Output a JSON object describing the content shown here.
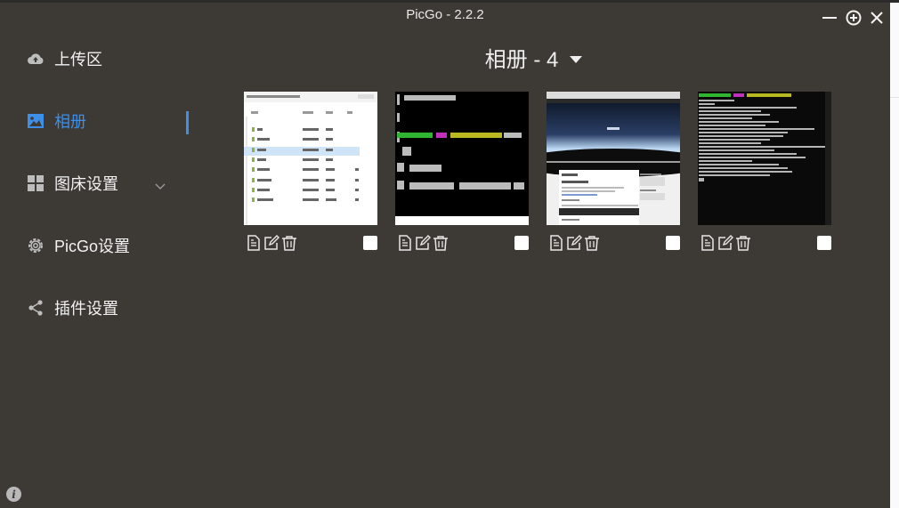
{
  "window": {
    "title": "PicGo - 2.2.2"
  },
  "sidebar": {
    "items": [
      {
        "label": "上传区",
        "icon": "cloud-upload-icon"
      },
      {
        "label": "相册",
        "icon": "image-icon"
      },
      {
        "label": "图床设置",
        "icon": "grid-icon"
      },
      {
        "label": "PicGo设置",
        "icon": "gear-icon"
      },
      {
        "label": "插件设置",
        "icon": "share-icon"
      }
    ]
  },
  "album": {
    "title": "相册 - 4",
    "count": 4
  },
  "gallery": [
    {
      "kind": "file-explorer"
    },
    {
      "kind": "terminal-dark"
    },
    {
      "kind": "blog-screenshot"
    },
    {
      "kind": "terminal-log"
    }
  ],
  "colors": {
    "background": "#3d3935",
    "accent": "#3d8fe8",
    "text": "#f2f2f2"
  }
}
